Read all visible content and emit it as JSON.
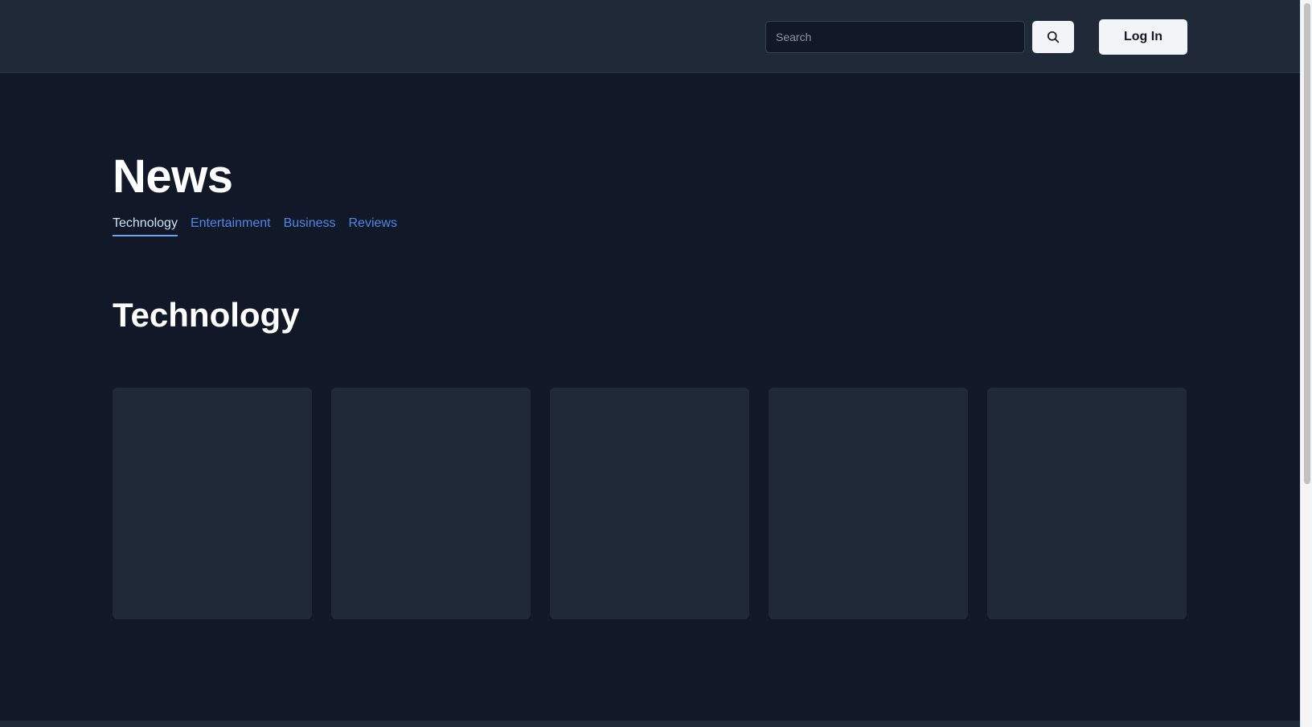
{
  "header": {
    "search_placeholder": "Search",
    "search_icon": "magnifying-glass",
    "login_label": "Log In"
  },
  "page": {
    "title": "News"
  },
  "categories": [
    {
      "label": "Technology",
      "active": true
    },
    {
      "label": "Entertainment",
      "active": false
    },
    {
      "label": "Business",
      "active": false
    },
    {
      "label": "Reviews",
      "active": false
    }
  ],
  "section": {
    "title": "Technology",
    "card_count": 5
  },
  "colors": {
    "page_background": "#111827",
    "header_background": "#1f2937",
    "card_background": "#1f2937",
    "link": "#4f88e8",
    "active_link": "#cfe0fb",
    "button_background": "#f3f4f6"
  }
}
